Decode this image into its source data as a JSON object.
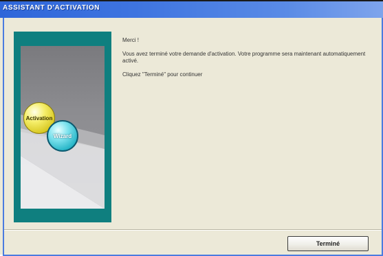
{
  "window": {
    "title": "ASSISTANT D'ACTIVATION"
  },
  "side_panel": {
    "badge_activation": "Activation",
    "badge_wizard": "Wizard"
  },
  "message": {
    "greeting": "Merci !",
    "body": "Vous avez terminé votre demande d'activation. Votre programme sera maintenant automatiquement activé.",
    "instruction": "Cliquez \"Terminé\" pour continuer"
  },
  "buttons": {
    "finish_label": "Terminé"
  },
  "colors": {
    "title_bar": "#3e74e0",
    "panel_teal": "#0f7f7f",
    "dialog_bg": "#ece9d8"
  }
}
